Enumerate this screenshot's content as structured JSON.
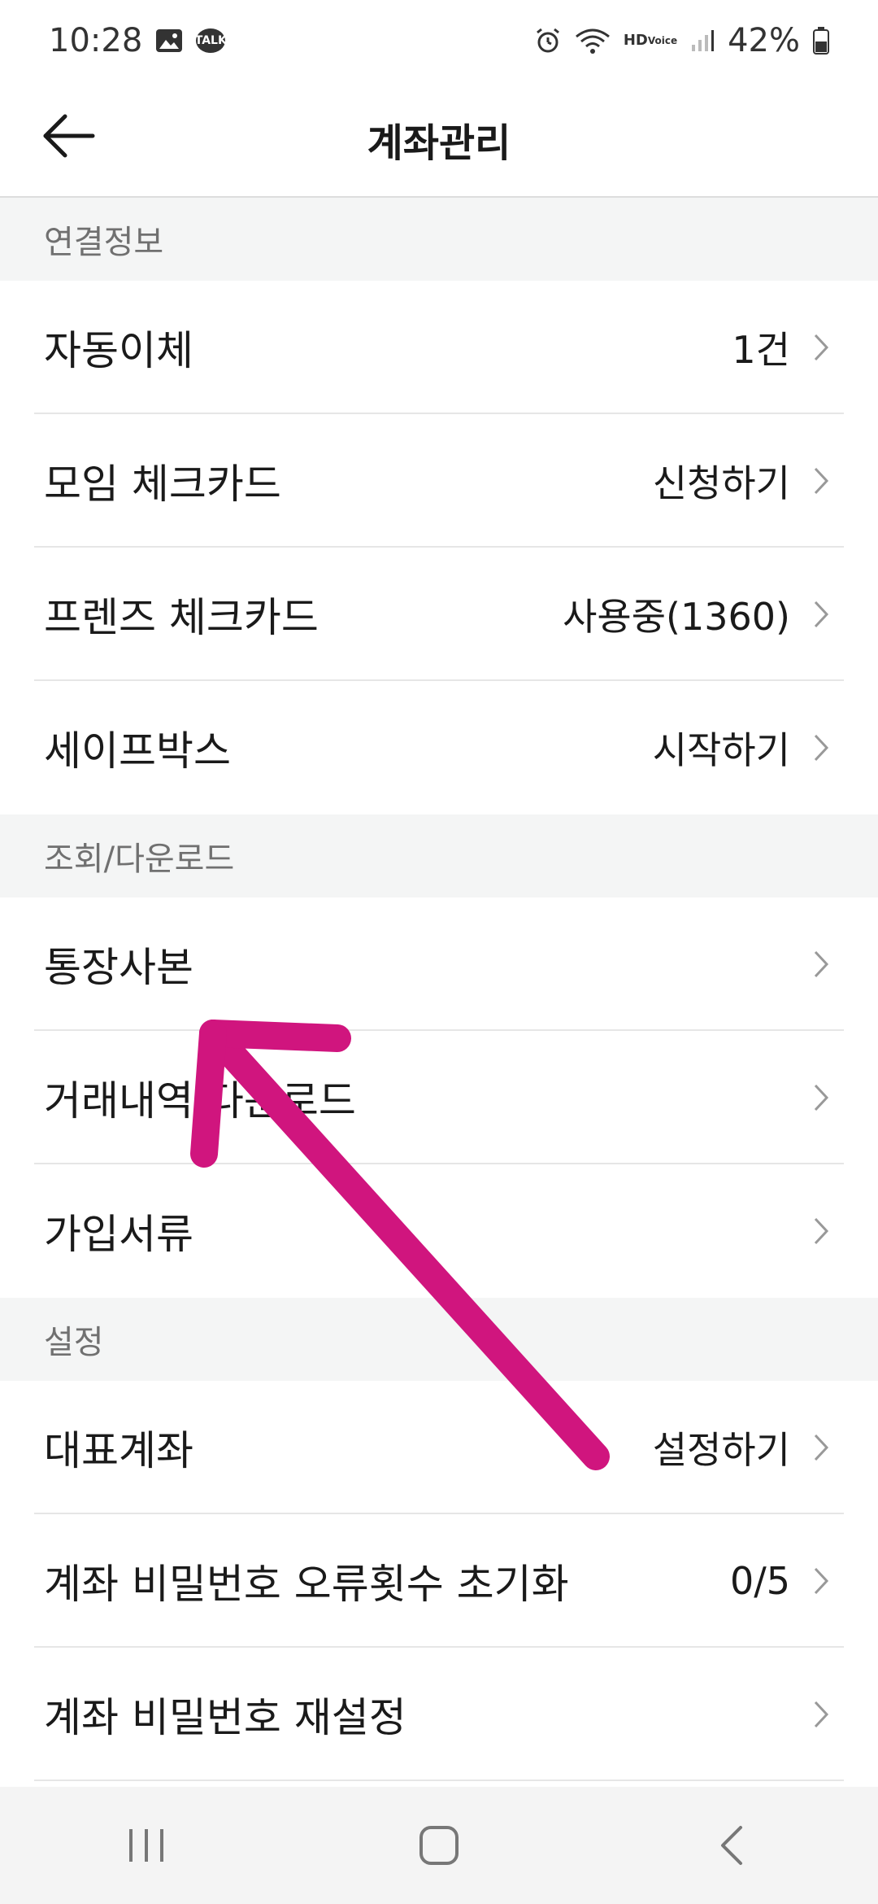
{
  "status_bar": {
    "time": "10:28",
    "kakao_label": "TALK",
    "hd_top": "HD",
    "hd_bottom": "Voice",
    "battery": "42%"
  },
  "header": {
    "title": "계좌관리",
    "back_icon": "arrow-left-icon"
  },
  "sections": [
    {
      "title": "연결정보",
      "items": [
        {
          "label": "자동이체",
          "value": "1건"
        },
        {
          "label": "모임 체크카드",
          "value": "신청하기"
        },
        {
          "label": "프렌즈 체크카드",
          "value": "사용중(1360)"
        },
        {
          "label": "세이프박스",
          "value": "시작하기"
        }
      ]
    },
    {
      "title": "조회/다운로드",
      "items": [
        {
          "label": "통장사본",
          "value": ""
        },
        {
          "label": "거래내역 다운로드",
          "value": ""
        },
        {
          "label": "가입서류",
          "value": ""
        }
      ]
    },
    {
      "title": "설정",
      "items": [
        {
          "label": "대표계좌",
          "value": "설정하기"
        },
        {
          "label": "계좌 비밀번호 오류횟수 초기화",
          "value": "0/5"
        },
        {
          "label": "계좌 비밀번호 재설정",
          "value": ""
        }
      ]
    }
  ],
  "colors": {
    "section_bg": "#f4f5f5",
    "annotation_arrow": "#d0157e"
  }
}
